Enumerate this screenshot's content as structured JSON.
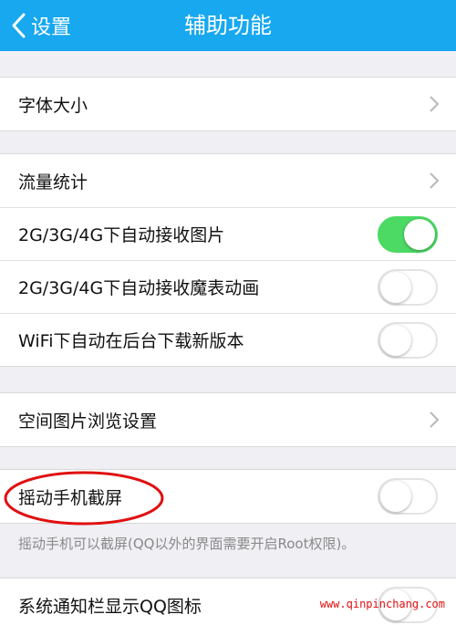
{
  "header": {
    "back_label": "设置",
    "title": "辅助功能"
  },
  "groups": [
    {
      "items": [
        {
          "label": "字体大小",
          "control": "arrow"
        }
      ]
    },
    {
      "items": [
        {
          "label": "流量统计",
          "control": "arrow"
        },
        {
          "label": "2G/3G/4G下自动接收图片",
          "control": "toggle",
          "on": true
        },
        {
          "label": "2G/3G/4G下自动接收魔表动画",
          "control": "toggle",
          "on": false
        },
        {
          "label": "WiFi下自动在后台下载新版本",
          "control": "toggle",
          "on": false
        }
      ]
    },
    {
      "items": [
        {
          "label": "空间图片浏览设置",
          "control": "arrow"
        }
      ]
    },
    {
      "items": [
        {
          "label": "摇动手机截屏",
          "control": "toggle",
          "on": false
        }
      ],
      "description": "摇动手机可以截屏(QQ以外的界面需要开启Root权限)。"
    },
    {
      "items": [
        {
          "label": "系统通知栏显示QQ图标",
          "control": "toggle",
          "on": false
        }
      ]
    }
  ],
  "watermark": "www.qinpinchang.com",
  "colors": {
    "header_bg": "#17a8f0",
    "toggle_on": "#4cd964",
    "annotation_red": "#e01010",
    "background": "#efeff4"
  }
}
